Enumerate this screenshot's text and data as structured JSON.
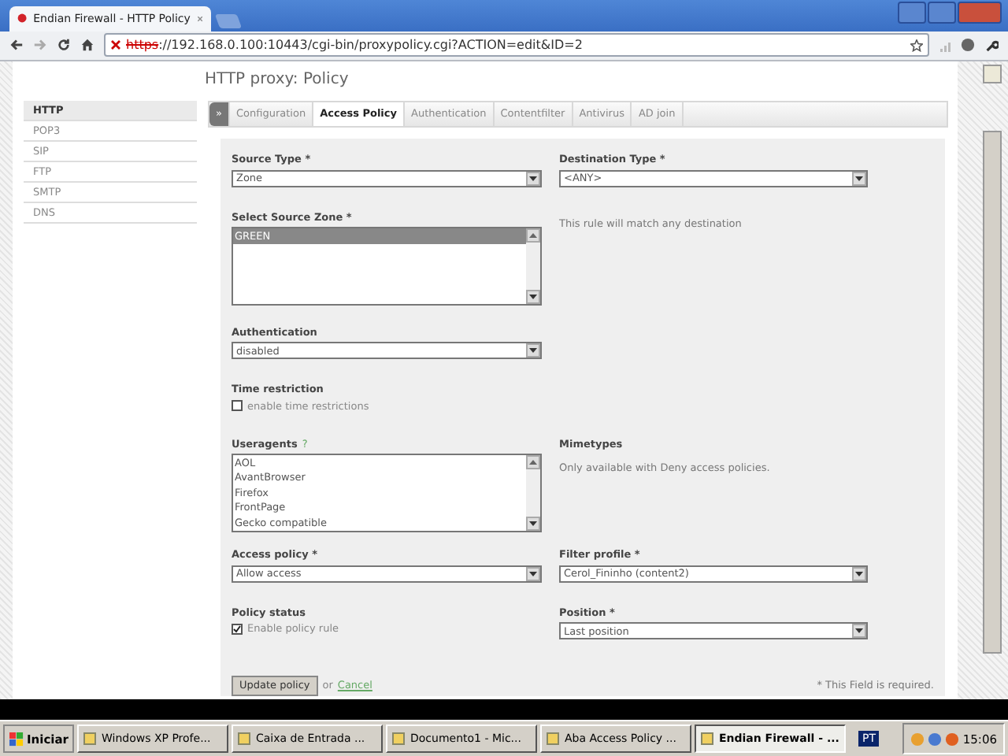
{
  "browser": {
    "tab_title": "Endian Firewall - HTTP Policy",
    "url_scheme": "https",
    "url_rest": "://192.168.0.100:10443/cgi-bin/proxypolicy.cgi?ACTION=edit&ID=2"
  },
  "page_title": "HTTP proxy: Policy",
  "sidebar": {
    "items": [
      {
        "label": "HTTP",
        "selected": true
      },
      {
        "label": "POP3",
        "selected": false
      },
      {
        "label": "SIP",
        "selected": false
      },
      {
        "label": "FTP",
        "selected": false
      },
      {
        "label": "SMTP",
        "selected": false
      },
      {
        "label": "DNS",
        "selected": false
      }
    ]
  },
  "tabs": [
    {
      "label": "»",
      "selected": false
    },
    {
      "label": "Configuration",
      "selected": false
    },
    {
      "label": "Access Policy",
      "selected": true
    },
    {
      "label": "Authentication",
      "selected": false
    },
    {
      "label": "Contentfilter",
      "selected": false
    },
    {
      "label": "Antivirus",
      "selected": false
    },
    {
      "label": "AD join",
      "selected": false
    }
  ],
  "form": {
    "rows": [
      {
        "left": {
          "kind": "select",
          "label": "Source Type *",
          "value": "Zone"
        },
        "right": {
          "kind": "select",
          "label": "Destination Type *",
          "value": "<ANY>"
        }
      },
      {
        "left": {
          "kind": "listbox",
          "label": "Select Source Zone *",
          "options": [
            {
              "label": "GREEN",
              "selected": true
            }
          ]
        },
        "right": {
          "kind": "note",
          "text": "This rule will match any destination"
        }
      },
      {
        "left": {
          "kind": "select",
          "label": "Authentication",
          "value": "disabled"
        }
      },
      {
        "left": {
          "kind": "checkbox",
          "label": "Time restriction",
          "option": "enable time restrictions",
          "checked": false
        }
      },
      {
        "left": {
          "kind": "listbox",
          "label": "Useragents",
          "help": "?",
          "options": [
            {
              "label": "AOL",
              "selected": false
            },
            {
              "label": "AvantBrowser",
              "selected": false
            },
            {
              "label": "Firefox",
              "selected": false
            },
            {
              "label": "FrontPage",
              "selected": false
            },
            {
              "label": "Gecko compatible",
              "selected": false
            }
          ]
        },
        "right": {
          "kind": "note",
          "label": "Mimetypes",
          "text": "Only available with Deny access policies."
        }
      },
      {
        "left": {
          "kind": "select",
          "label": "Access policy *",
          "value": "Allow access"
        },
        "right": {
          "kind": "select",
          "label": "Filter profile *",
          "value": "Cerol_Fininho (content2)"
        }
      },
      {
        "left": {
          "kind": "checkbox",
          "label": "Policy status",
          "option": "Enable policy rule",
          "checked": true
        },
        "right": {
          "kind": "select",
          "label": "Position *",
          "value": "Last position"
        }
      }
    ],
    "submit": "Update policy",
    "or": "or",
    "cancel": "Cancel",
    "required_note": "* This Field is required."
  },
  "taskbar": {
    "start": "Iniciar",
    "items": [
      {
        "label": "Windows XP Profe...",
        "selected": false
      },
      {
        "label": "Caixa de Entrada ...",
        "selected": false
      },
      {
        "label": "Documento1 - Mic...",
        "selected": false
      },
      {
        "label": "Aba Access Policy ...",
        "selected": false
      },
      {
        "label": "Endian Firewall - ...",
        "selected": true
      }
    ],
    "language": "PT",
    "clock": "15:06"
  }
}
